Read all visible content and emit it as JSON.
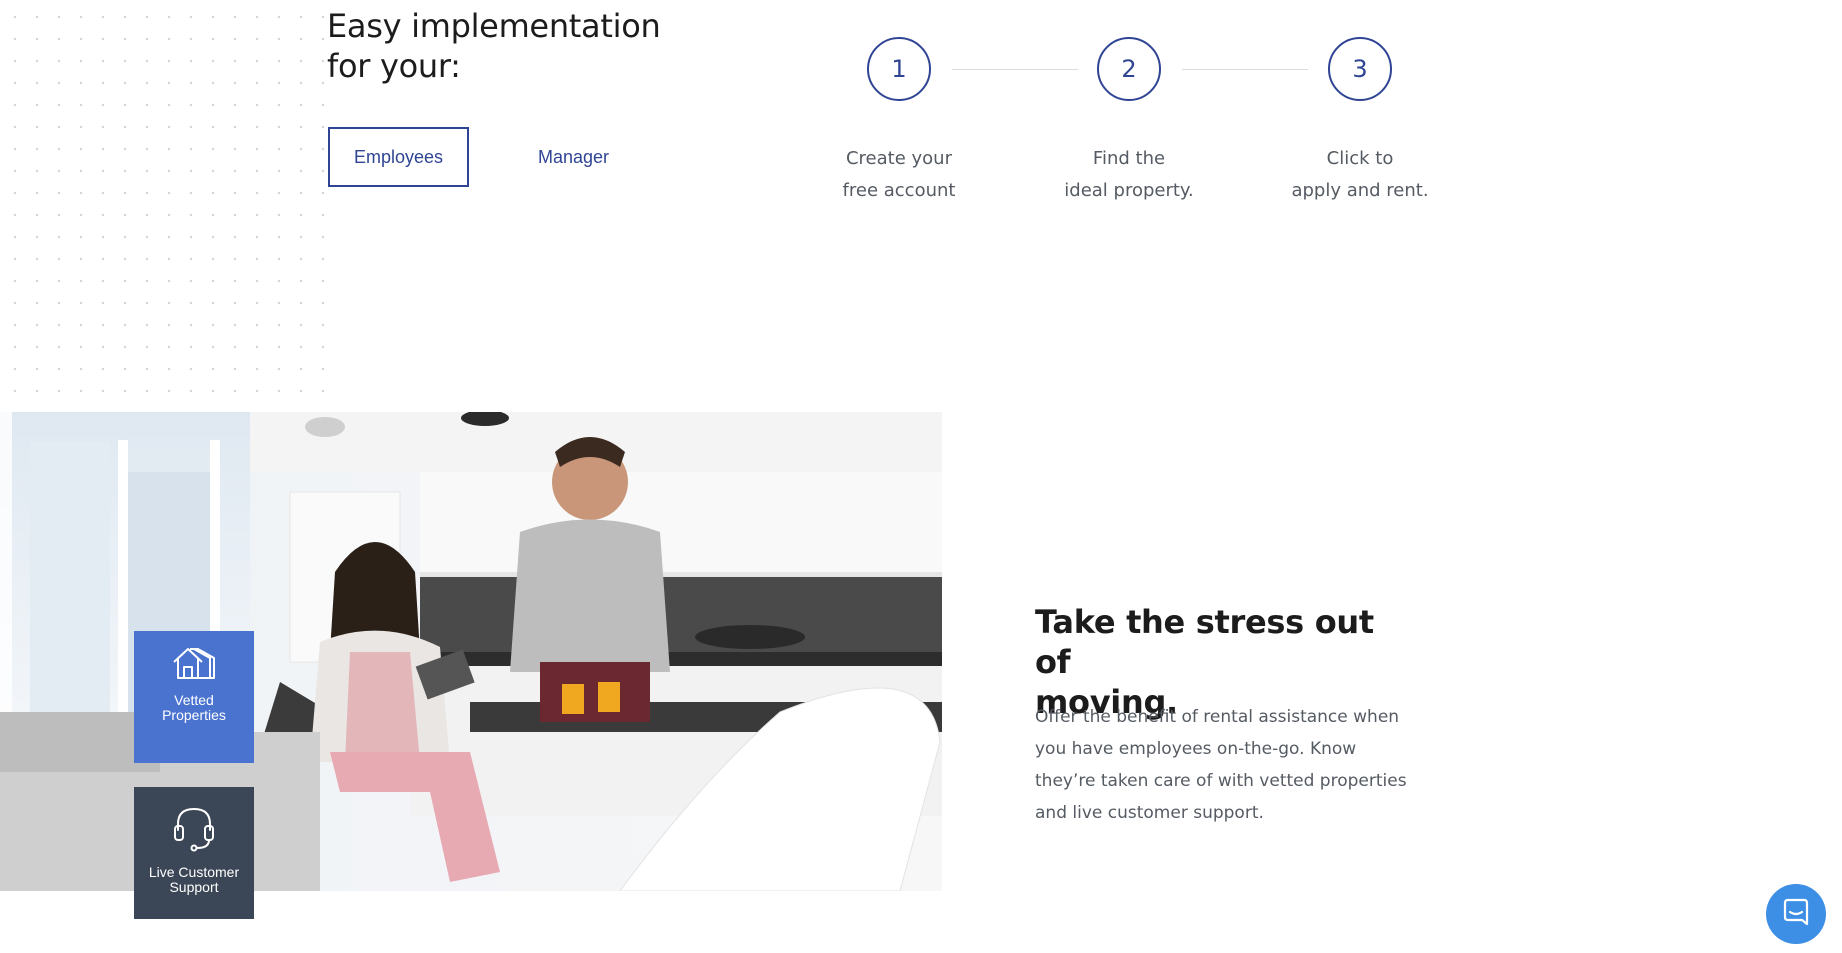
{
  "implementation": {
    "title_line1": "Easy implementation",
    "title_line2": "for your:",
    "tabs": [
      {
        "label": "Employees",
        "active": true
      },
      {
        "label": "Manager",
        "active": false
      }
    ]
  },
  "steps": [
    {
      "number": "1",
      "line1": "Create your",
      "line2": "free account"
    },
    {
      "number": "2",
      "line1": "Find the",
      "line2": "ideal property."
    },
    {
      "number": "3",
      "line1": "Click to",
      "line2": "apply and rent."
    }
  ],
  "features": [
    {
      "label_line1": "Vetted",
      "label_line2": "Properties",
      "icon": "house-icon"
    },
    {
      "label_line1": "Live Customer",
      "label_line2": "Support",
      "icon": "headset-icon"
    }
  ],
  "stress_section": {
    "title_line1": "Take the stress out of",
    "title_line2": "moving.",
    "body": "Offer the benefit of rental assistance when you have employees on-the-go. Know they’re taken care of with vetted properties and live customer support."
  },
  "chat": {
    "icon": "chat-icon"
  },
  "colors": {
    "accent": "#2f4594",
    "tile_blue": "#4a73d0",
    "tile_dark": "#3b4656",
    "chat_blue": "#3d8fe6",
    "body_text": "#555b63"
  }
}
